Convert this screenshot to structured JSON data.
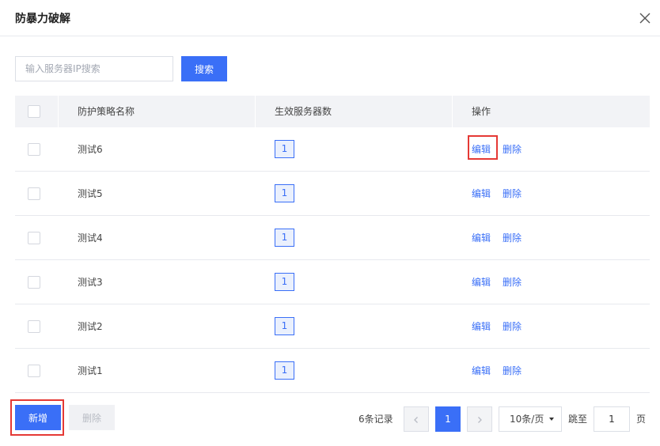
{
  "dialog": {
    "title": "防暴力破解",
    "close_icon": "close-icon"
  },
  "search": {
    "placeholder": "输入服务器IP搜索",
    "value": "",
    "button_label": "搜索"
  },
  "table": {
    "columns": [
      "防护策略名称",
      "生效服务器数",
      "操作"
    ],
    "select_all_checked": false,
    "rows": [
      {
        "name": "测试6",
        "server_count": "1",
        "edit_label": "编辑",
        "delete_label": "删除",
        "checked": false,
        "edit_highlighted": true
      },
      {
        "name": "测试5",
        "server_count": "1",
        "edit_label": "编辑",
        "delete_label": "删除",
        "checked": false
      },
      {
        "name": "测试4",
        "server_count": "1",
        "edit_label": "编辑",
        "delete_label": "删除",
        "checked": false
      },
      {
        "name": "测试3",
        "server_count": "1",
        "edit_label": "编辑",
        "delete_label": "删除",
        "checked": false
      },
      {
        "name": "测试2",
        "server_count": "1",
        "edit_label": "编辑",
        "delete_label": "删除",
        "checked": false
      },
      {
        "name": "测试1",
        "server_count": "1",
        "edit_label": "编辑",
        "delete_label": "删除",
        "checked": false
      }
    ]
  },
  "footer": {
    "add_label": "新增",
    "add_highlighted": true,
    "delete_label": "删除",
    "total_text": "6条记录",
    "current_page": "1",
    "page_size": "10条/页",
    "jump_label": "跳至",
    "jump_value": "1",
    "page_unit": "页"
  },
  "colors": {
    "accent": "#3a6ff7",
    "highlight": "#e53935",
    "header_bg": "#f2f3f6"
  }
}
